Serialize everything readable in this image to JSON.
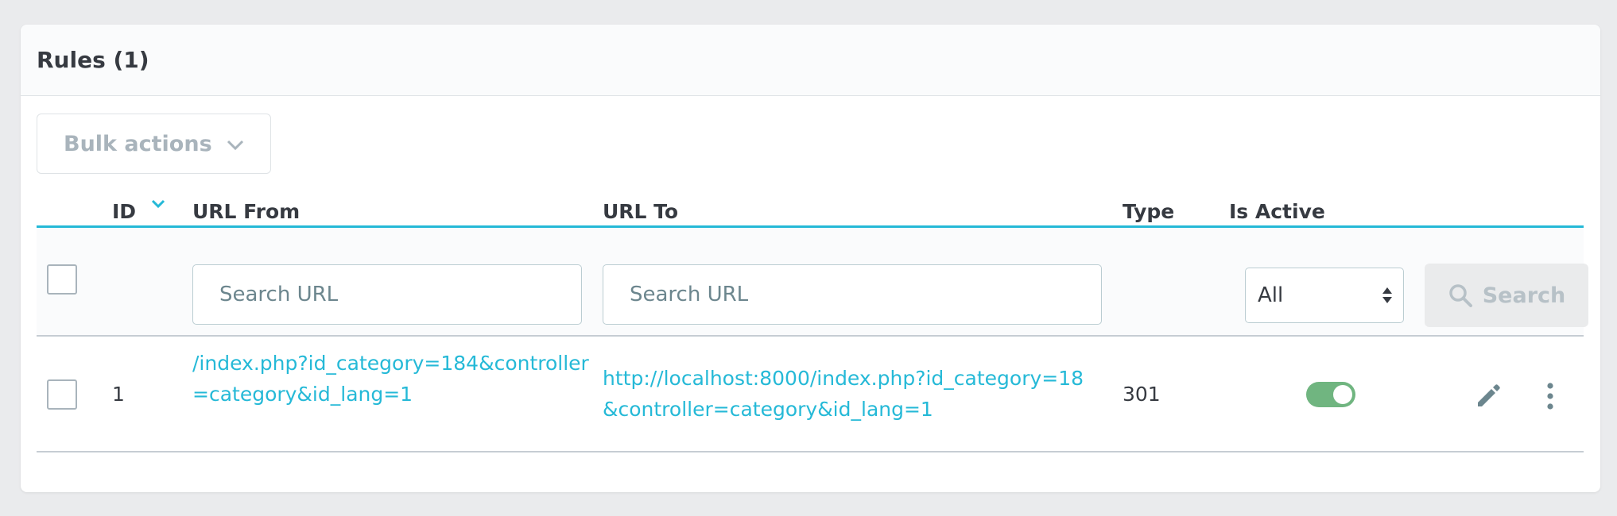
{
  "panel": {
    "title": "Rules (1)"
  },
  "bulk_actions": {
    "label": "Bulk actions"
  },
  "columns": {
    "id": "ID",
    "url_from": "URL From",
    "url_to": "URL To",
    "type": "Type",
    "is_active": "Is Active"
  },
  "filters": {
    "url_from_placeholder": "Search URL",
    "url_to_placeholder": "Search URL",
    "is_active_value": "All",
    "search_label": "Search"
  },
  "rows": [
    {
      "id": "1",
      "url_from": "/index.php?id_category=184&controller=category&id_lang=1",
      "url_to": "http://localhost:8000/index.php?id_category=18&controller=category&id_lang=1",
      "type": "301",
      "active": true
    }
  ],
  "colors": {
    "accent": "#25b9d7",
    "toggle_on": "#70b580"
  },
  "icons": {
    "sort": "chevron-down-icon",
    "bulk": "chevron-down-icon",
    "select": "up-down-arrows-icon",
    "search": "magnifier-icon",
    "edit": "pencil-icon",
    "more": "kebab-menu-icon"
  }
}
